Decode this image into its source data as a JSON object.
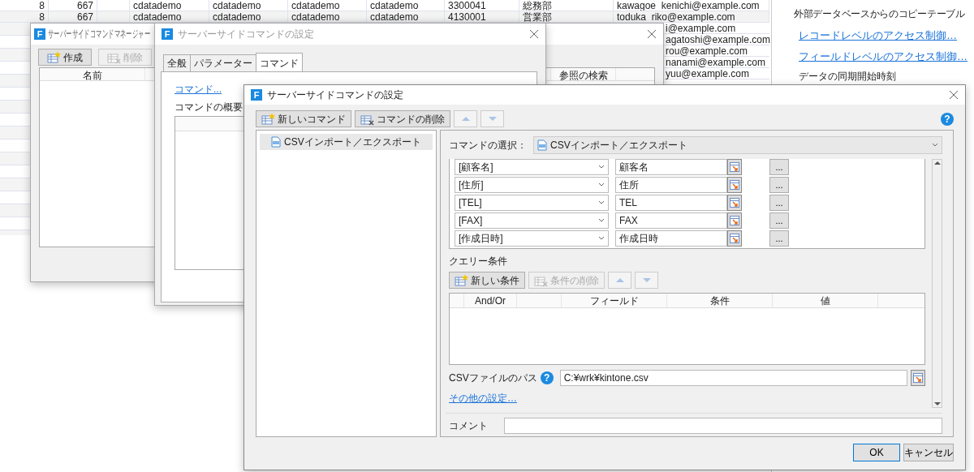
{
  "sheet": {
    "rows": [
      {
        "cells": [
          "8",
          "667",
          "",
          "cdatademo",
          "cdatademo",
          "cdatademo",
          "cdatademo",
          "3300041",
          "総務部",
          "kawagoe_kenichi@example.com"
        ]
      },
      {
        "cells": [
          "8",
          "667",
          "",
          "cdatademo",
          "cdatademo",
          "cdatademo",
          "cdatademo",
          "4130001",
          "営業部",
          "toduka_riko@example.com"
        ]
      }
    ],
    "email_fragments": [
      "i@example.com",
      "agatoshi@example.com",
      "rou@example.com",
      "nanami@example.com",
      "yuu@example.com"
    ]
  },
  "side_panel": {
    "items": [
      {
        "kind": "text",
        "text": "外部データベースからのコピーテーブル"
      },
      {
        "kind": "link",
        "text": "レコードレベルのアクセス制御…"
      },
      {
        "kind": "link",
        "text": "フィールドレベルのアクセス制御…"
      },
      {
        "kind": "heading",
        "text": "データの同期開始時刻"
      }
    ]
  },
  "manager_window": {
    "icon_letter": "F",
    "title": "サーバーサイドコマンドマネージャー",
    "buttons": [
      {
        "label": "作成",
        "kind": "new",
        "disabled": false
      },
      {
        "label": "削除",
        "kind": "delete",
        "disabled": true
      }
    ],
    "columns": [
      "名前",
      "参照の検索"
    ]
  },
  "back_settings_window": {
    "icon_letter": "F",
    "title": "サーバーサイドコマンドの設定",
    "tabs": [
      {
        "label": "全般",
        "selected": false
      },
      {
        "label": "パラメーター",
        "selected": false
      },
      {
        "label": "コマンド",
        "selected": true
      }
    ],
    "command_link": "コマンド...",
    "summary_label": "コマンドの概要"
  },
  "dialog": {
    "icon_letter": "F",
    "title": "サーバーサイドコマンドの設定",
    "help": "?",
    "toolbar": [
      {
        "kind": "new",
        "label": "新しいコマンド",
        "disabled": false
      },
      {
        "kind": "delete",
        "label": "コマンドの削除",
        "disabled": false
      },
      {
        "kind": "up",
        "disabled": true
      },
      {
        "kind": "down",
        "disabled": true
      }
    ],
    "commands": [
      {
        "label": "CSVインポート／エクスポート",
        "selected": true
      }
    ],
    "command_select_label": "コマンドの選択：",
    "command_select_value": "CSVインポート／エクスポート",
    "mappings": [
      {
        "field": "[顧客名]",
        "column": "顧客名",
        "button": "..."
      },
      {
        "field": "[住所]",
        "column": "住所",
        "button": "..."
      },
      {
        "field": "[TEL]",
        "column": "TEL",
        "button": "..."
      },
      {
        "field": "[FAX]",
        "column": "FAX",
        "button": "..."
      },
      {
        "field": "[作成日時]",
        "column": "作成日時",
        "button": "..."
      }
    ],
    "query_label": "クエリー条件",
    "query_buttons": [
      {
        "kind": "new",
        "label": "新しい条件",
        "disabled": false
      },
      {
        "kind": "delete",
        "label": "条件の削除",
        "disabled": true
      },
      {
        "kind": "up",
        "disabled": true
      },
      {
        "kind": "down",
        "disabled": true
      }
    ],
    "query_columns": [
      "And/Or",
      "フィールド",
      "条件",
      "値"
    ],
    "csv_path_label": "CSVファイルのパス",
    "csv_help": "?",
    "csv_path": "C:¥wrk¥kintone.csv",
    "other_settings_link": "その他の設定…",
    "comment_label": "コメント",
    "buttons": [
      {
        "label": "OK",
        "default": true
      },
      {
        "label": "キャンセル",
        "default": false
      }
    ]
  }
}
